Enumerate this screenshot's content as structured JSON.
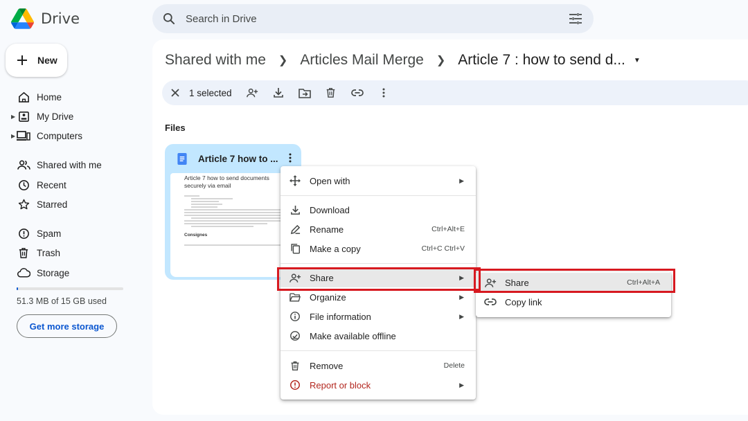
{
  "app": {
    "name": "Drive"
  },
  "search": {
    "placeholder": "Search in Drive"
  },
  "sidebar": {
    "new_label": "New",
    "items": [
      {
        "label": "Home"
      },
      {
        "label": "My Drive"
      },
      {
        "label": "Computers"
      },
      {
        "label": "Shared with me"
      },
      {
        "label": "Recent"
      },
      {
        "label": "Starred"
      },
      {
        "label": "Spam"
      },
      {
        "label": "Trash"
      },
      {
        "label": "Storage"
      }
    ],
    "storage_used_fraction": 0.0034,
    "storage_text": "51.3 MB of 15 GB used",
    "get_storage_label": "Get more storage"
  },
  "breadcrumb": {
    "items": [
      "Shared with me",
      "Articles Mail Merge",
      "Article 7 : how to send d..."
    ]
  },
  "selection": {
    "count_label": "1 selected"
  },
  "files": {
    "section_label": "Files",
    "card_title": "Article 7 how to ...",
    "thumb_title": "Article 7 how to send documents securely via email",
    "thumb_heading": "Consignes"
  },
  "context_menu": {
    "items": [
      {
        "label": "Open with",
        "shortcut": ""
      },
      {
        "label": "Download",
        "shortcut": ""
      },
      {
        "label": "Rename",
        "shortcut": "Ctrl+Alt+E"
      },
      {
        "label": "Make a copy",
        "shortcut": "Ctrl+C Ctrl+V"
      },
      {
        "label": "Share",
        "shortcut": ""
      },
      {
        "label": "Organize",
        "shortcut": ""
      },
      {
        "label": "File information",
        "shortcut": ""
      },
      {
        "label": "Make available offline",
        "shortcut": ""
      },
      {
        "label": "Remove",
        "shortcut": "Delete"
      },
      {
        "label": "Report or block",
        "shortcut": ""
      }
    ]
  },
  "share_submenu": {
    "items": [
      {
        "label": "Share",
        "shortcut": "Ctrl+Alt+A"
      },
      {
        "label": "Copy link",
        "shortcut": ""
      }
    ]
  },
  "colors": {
    "accent": "#0b57d0",
    "card_bg": "#c2e7ff",
    "highlight_box": "#d71920",
    "danger": "#b3261e"
  }
}
